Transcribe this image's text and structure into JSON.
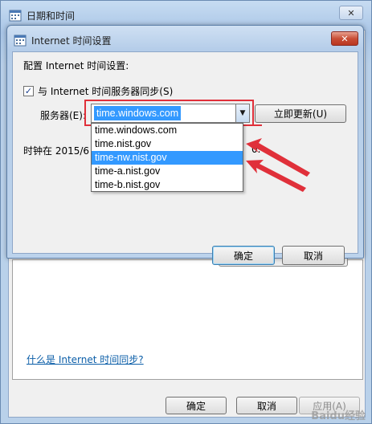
{
  "outer_window": {
    "title": "日期和时间",
    "close_glyph": "✕",
    "link_text": "什么是 Internet 时间同步?",
    "buttons": {
      "ok": "确定",
      "cancel": "取消",
      "apply": "应用(A)"
    }
  },
  "dialog": {
    "title": "Internet 时间设置",
    "close_glyph": "✕",
    "section_label": "配置 Internet 时间设置:",
    "sync_checkbox": {
      "label": "与 Internet 时间服务器同步(S)",
      "checked": true,
      "check_glyph": "✓"
    },
    "server_label": "服务器(E):",
    "server_value": "time.windows.com",
    "dropdown_arrow_glyph": "▼",
    "update_button": "立即更新(U)",
    "clock_text": "时钟在 2015/6",
    "clock_text_tail": "0.",
    "dropdown_options": [
      {
        "label": "time.windows.com",
        "selected": false
      },
      {
        "label": "time.nist.gov",
        "selected": false
      },
      {
        "label": "time-nw.nist.gov",
        "selected": true
      },
      {
        "label": "time-a.nist.gov",
        "selected": false
      },
      {
        "label": "time-b.nist.gov",
        "selected": false
      }
    ],
    "ok_button": "确定",
    "cancel_button": "取消"
  },
  "watermark": "Baidu经验",
  "colors": {
    "selection": "#3399ff",
    "annotation_red": "#e0303a",
    "link": "#0b5ea8",
    "title_bar": "#b9d1ea"
  }
}
